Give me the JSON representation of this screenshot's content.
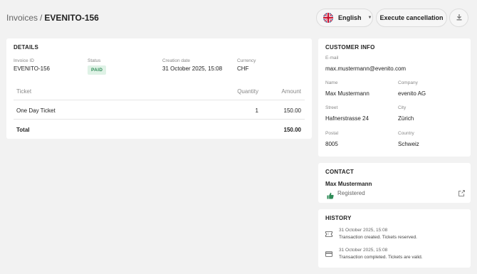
{
  "breadcrumb": {
    "parent": "Invoices",
    "separator": "/",
    "current": "EVENITO-156"
  },
  "toolbar": {
    "language": "English",
    "execute_cancellation": "Execute cancellation"
  },
  "details": {
    "title": "DETAILS",
    "invoice_id_label": "Invoice ID",
    "invoice_id": "EVENITO-156",
    "status_label": "Status",
    "status": "PAID",
    "creation_date_label": "Creation date",
    "creation_date": "31 October 2025, 15:08",
    "currency_label": "Currency",
    "currency": "CHF",
    "table": {
      "headers": {
        "ticket": "Ticket",
        "quantity": "Quantity",
        "amount": "Amount"
      },
      "rows": [
        {
          "ticket": "One Day Ticket",
          "quantity": "1",
          "amount": "150.00"
        }
      ],
      "total_label": "Total",
      "total": "150.00"
    }
  },
  "customer": {
    "title": "CUSTOMER INFO",
    "email_label": "E-mail",
    "email": "max.mustermann@evenito.com",
    "name_label": "Name",
    "name": "Max Mustermann",
    "company_label": "Company",
    "company": "evenito AG",
    "street_label": "Street",
    "street": "Hafnerstrasse 24",
    "city_label": "City",
    "city": "Zürich",
    "postal_label": "Postal",
    "postal": "8005",
    "country_label": "Country",
    "country": "Schweiz"
  },
  "contact": {
    "title": "CONTACT",
    "name": "Max Mustermann",
    "status": "Registered"
  },
  "history": {
    "title": "HISTORY",
    "items": [
      {
        "icon": "ticket-icon",
        "date": "31 October 2025, 15:08",
        "text": "Transaction created. Tickets reserved."
      },
      {
        "icon": "credit-card-icon",
        "date": "31 October 2025, 15:08",
        "text": "Transaction completed. Tickets are valid."
      }
    ]
  },
  "colors": {
    "background": "#f2f2f2",
    "card": "#ffffff",
    "paid_badge_bg": "#dff2e6",
    "paid_badge_text": "#2e8b57",
    "thumb_icon": "#2e8b57"
  }
}
